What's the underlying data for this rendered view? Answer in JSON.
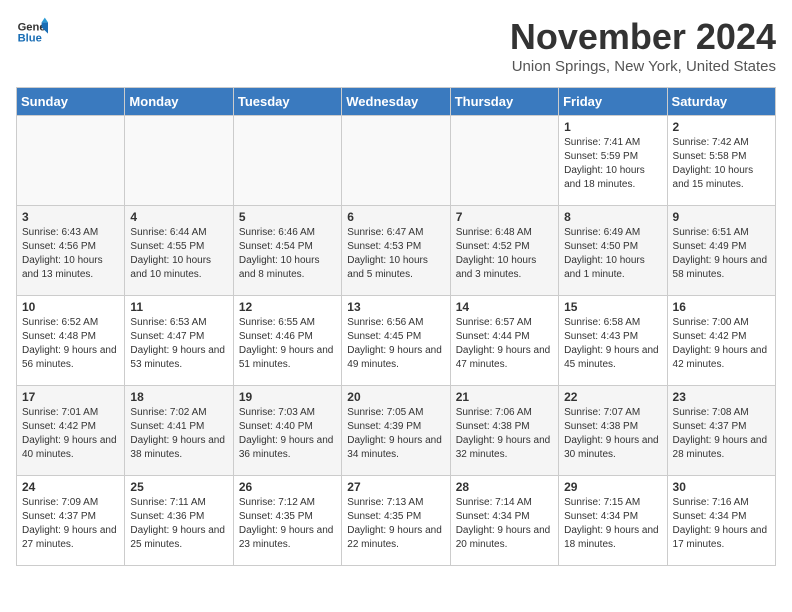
{
  "logo": {
    "line1": "General",
    "line2": "Blue"
  },
  "title": "November 2024",
  "location": "Union Springs, New York, United States",
  "days_of_week": [
    "Sunday",
    "Monday",
    "Tuesday",
    "Wednesday",
    "Thursday",
    "Friday",
    "Saturday"
  ],
  "weeks": [
    [
      {
        "day": "",
        "info": ""
      },
      {
        "day": "",
        "info": ""
      },
      {
        "day": "",
        "info": ""
      },
      {
        "day": "",
        "info": ""
      },
      {
        "day": "",
        "info": ""
      },
      {
        "day": "1",
        "info": "Sunrise: 7:41 AM\nSunset: 5:59 PM\nDaylight: 10 hours and 18 minutes."
      },
      {
        "day": "2",
        "info": "Sunrise: 7:42 AM\nSunset: 5:58 PM\nDaylight: 10 hours and 15 minutes."
      }
    ],
    [
      {
        "day": "3",
        "info": "Sunrise: 6:43 AM\nSunset: 4:56 PM\nDaylight: 10 hours and 13 minutes."
      },
      {
        "day": "4",
        "info": "Sunrise: 6:44 AM\nSunset: 4:55 PM\nDaylight: 10 hours and 10 minutes."
      },
      {
        "day": "5",
        "info": "Sunrise: 6:46 AM\nSunset: 4:54 PM\nDaylight: 10 hours and 8 minutes."
      },
      {
        "day": "6",
        "info": "Sunrise: 6:47 AM\nSunset: 4:53 PM\nDaylight: 10 hours and 5 minutes."
      },
      {
        "day": "7",
        "info": "Sunrise: 6:48 AM\nSunset: 4:52 PM\nDaylight: 10 hours and 3 minutes."
      },
      {
        "day": "8",
        "info": "Sunrise: 6:49 AM\nSunset: 4:50 PM\nDaylight: 10 hours and 1 minute."
      },
      {
        "day": "9",
        "info": "Sunrise: 6:51 AM\nSunset: 4:49 PM\nDaylight: 9 hours and 58 minutes."
      }
    ],
    [
      {
        "day": "10",
        "info": "Sunrise: 6:52 AM\nSunset: 4:48 PM\nDaylight: 9 hours and 56 minutes."
      },
      {
        "day": "11",
        "info": "Sunrise: 6:53 AM\nSunset: 4:47 PM\nDaylight: 9 hours and 53 minutes."
      },
      {
        "day": "12",
        "info": "Sunrise: 6:55 AM\nSunset: 4:46 PM\nDaylight: 9 hours and 51 minutes."
      },
      {
        "day": "13",
        "info": "Sunrise: 6:56 AM\nSunset: 4:45 PM\nDaylight: 9 hours and 49 minutes."
      },
      {
        "day": "14",
        "info": "Sunrise: 6:57 AM\nSunset: 4:44 PM\nDaylight: 9 hours and 47 minutes."
      },
      {
        "day": "15",
        "info": "Sunrise: 6:58 AM\nSunset: 4:43 PM\nDaylight: 9 hours and 45 minutes."
      },
      {
        "day": "16",
        "info": "Sunrise: 7:00 AM\nSunset: 4:42 PM\nDaylight: 9 hours and 42 minutes."
      }
    ],
    [
      {
        "day": "17",
        "info": "Sunrise: 7:01 AM\nSunset: 4:42 PM\nDaylight: 9 hours and 40 minutes."
      },
      {
        "day": "18",
        "info": "Sunrise: 7:02 AM\nSunset: 4:41 PM\nDaylight: 9 hours and 38 minutes."
      },
      {
        "day": "19",
        "info": "Sunrise: 7:03 AM\nSunset: 4:40 PM\nDaylight: 9 hours and 36 minutes."
      },
      {
        "day": "20",
        "info": "Sunrise: 7:05 AM\nSunset: 4:39 PM\nDaylight: 9 hours and 34 minutes."
      },
      {
        "day": "21",
        "info": "Sunrise: 7:06 AM\nSunset: 4:38 PM\nDaylight: 9 hours and 32 minutes."
      },
      {
        "day": "22",
        "info": "Sunrise: 7:07 AM\nSunset: 4:38 PM\nDaylight: 9 hours and 30 minutes."
      },
      {
        "day": "23",
        "info": "Sunrise: 7:08 AM\nSunset: 4:37 PM\nDaylight: 9 hours and 28 minutes."
      }
    ],
    [
      {
        "day": "24",
        "info": "Sunrise: 7:09 AM\nSunset: 4:37 PM\nDaylight: 9 hours and 27 minutes."
      },
      {
        "day": "25",
        "info": "Sunrise: 7:11 AM\nSunset: 4:36 PM\nDaylight: 9 hours and 25 minutes."
      },
      {
        "day": "26",
        "info": "Sunrise: 7:12 AM\nSunset: 4:35 PM\nDaylight: 9 hours and 23 minutes."
      },
      {
        "day": "27",
        "info": "Sunrise: 7:13 AM\nSunset: 4:35 PM\nDaylight: 9 hours and 22 minutes."
      },
      {
        "day": "28",
        "info": "Sunrise: 7:14 AM\nSunset: 4:34 PM\nDaylight: 9 hours and 20 minutes."
      },
      {
        "day": "29",
        "info": "Sunrise: 7:15 AM\nSunset: 4:34 PM\nDaylight: 9 hours and 18 minutes."
      },
      {
        "day": "30",
        "info": "Sunrise: 7:16 AM\nSunset: 4:34 PM\nDaylight: 9 hours and 17 minutes."
      }
    ]
  ]
}
